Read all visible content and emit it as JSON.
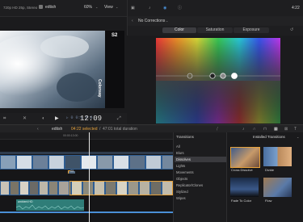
{
  "viewer": {
    "format": "720p HD 25p, Stereo",
    "project": "edtish",
    "zoom": "60%",
    "view_label": "View",
    "clip_label": "S2",
    "side_label": "Colonsay",
    "timecode": "12:09"
  },
  "inspector": {
    "time": "4:22",
    "correction": "No Corrections",
    "tabs": [
      "Color",
      "Saturation",
      "Exposure"
    ],
    "active_tab": "Color"
  },
  "timeline_bar": {
    "project": "edtish",
    "selection": "04:22 selected",
    "total": "47:01 total duration",
    "ruler_time": "00:00:13:00"
  },
  "clips": {
    "lower_label": "S5",
    "audio_label": "ambient HD"
  },
  "transitions": {
    "header": "Transitions",
    "title": "Installed Transitions",
    "categories": [
      "All",
      "Blurs",
      "Dissolves",
      "Lights",
      "Movements",
      "Objects",
      "Replicator/Clones",
      "Stylized",
      "Wipes"
    ],
    "selected_category": "Dissolves",
    "items": [
      "Cross Dissolve",
      "Divide",
      "Fade To Color",
      "Flow"
    ]
  },
  "colors": {
    "accent": "#e6a23c",
    "selection_blue": "#4a8fd6",
    "clip_blue": "#2e5d92",
    "audio_teal": "#2f7d78"
  }
}
